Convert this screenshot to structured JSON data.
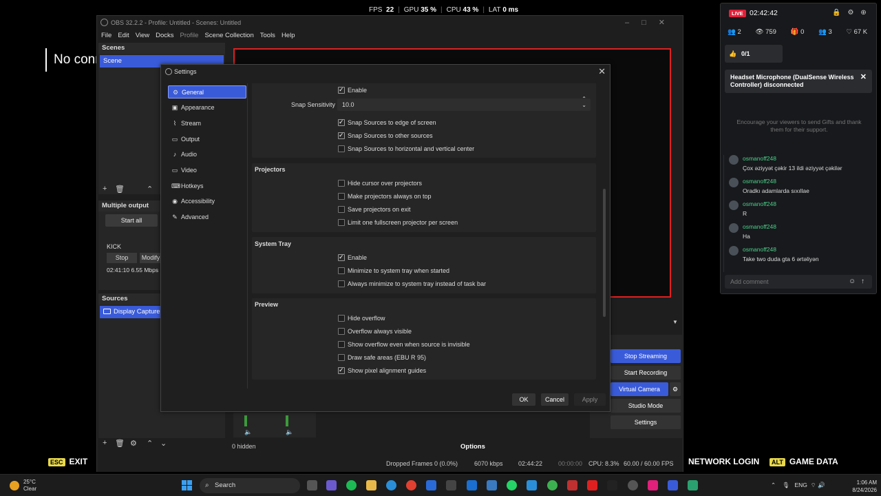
{
  "top_stats": {
    "fps_label": "FPS",
    "fps": "22",
    "gpu_label": "GPU",
    "gpu": "35 %",
    "cpu_label": "CPU",
    "cpu": "43 %",
    "lat_label": "LAT",
    "lat": "0 ms"
  },
  "overlay_left_text": "No connection",
  "obs": {
    "title": "OBS 32.2.2 - Profile: Untitled - Scenes: Untitled",
    "menu": [
      "File",
      "Edit",
      "View",
      "Docks",
      "Profile",
      "Scene Collection",
      "Tools",
      "Help"
    ],
    "scenes_header": "Scenes",
    "scene_item": "Scene",
    "multiple_output_header": "Multiple output",
    "start_all": "Start all",
    "kick_label": "KICK",
    "stop_label": "Stop",
    "modify_label": "Modify",
    "kick_stats": "02:41:10  6.55 Mbps",
    "sources_header": "Sources",
    "source_item": "Display Capture",
    "controls": {
      "stop_streaming": "Stop Streaming",
      "start_recording": "Start Recording",
      "virtual_camera": "Virtual Camera",
      "studio_mode": "Studio Mode",
      "settings": "Settings"
    },
    "hidden_label": "0 hidden",
    "options_label": "Options",
    "status": {
      "dropped": "Dropped Frames 0 (0.0%)",
      "kbps": "6070 kbps",
      "stream_time": "02:44:22",
      "rec_time": "00:00:00",
      "cpu": "CPU: 8.3%",
      "fps": "60.00 / 60.00 FPS"
    }
  },
  "hud": {
    "esc_key": "ESC",
    "exit_label": "EXIT",
    "network_login": "NETWORK LOGIN",
    "alt_key": "ALT",
    "game_data": "GAME DATA"
  },
  "chat": {
    "live_badge": "LIVE",
    "live_time": "02:42:42",
    "stats": [
      "2",
      "759",
      "0",
      "3",
      "67 K"
    ],
    "goal": "0/1",
    "notification": "Headset Microphone (DualSense Wireless Controller) disconnected",
    "encourage": "Encourage your viewers to send Gifts and thank them for their support.",
    "messages": [
      {
        "user": "osmanoff248",
        "text": "Çox əziyyət çəkir 13 ildi əziyyət çəkilər"
      },
      {
        "user": "osmanoff248",
        "text": "Oradkı adamlarda sıxıllae"
      },
      {
        "user": "osmanoff248",
        "text": "R"
      },
      {
        "user": "osmanoff248",
        "text": "Ha"
      },
      {
        "user": "osmanoff248",
        "text": "Take two duda gta 6 ərtəliyən"
      }
    ],
    "add_comment_placeholder": "Add comment"
  },
  "settings": {
    "title": "Settings",
    "nav": [
      "General",
      "Appearance",
      "Stream",
      "Output",
      "Audio",
      "Video",
      "Hotkeys",
      "Accessibility",
      "Advanced"
    ],
    "active_nav": "General",
    "snapping": {
      "enable": "Enable",
      "sensitivity_label": "Snap Sensitivity",
      "sensitivity_value": "10.0",
      "edge": "Snap Sources to edge of screen",
      "other": "Snap Sources to other sources",
      "center": "Snap Sources to horizontal and vertical center"
    },
    "projectors": {
      "title": "Projectors",
      "hide_cursor": "Hide cursor over projectors",
      "always_on_top": "Make projectors always on top",
      "save_on_exit": "Save projectors on exit",
      "limit_one": "Limit one fullscreen projector per screen"
    },
    "system_tray": {
      "title": "System Tray",
      "enable": "Enable",
      "minimize_started": "Minimize to system tray when started",
      "always_minimize": "Always minimize to system tray instead of task bar"
    },
    "preview": {
      "title": "Preview",
      "hide_overflow": "Hide overflow",
      "overflow_visible": "Overflow always visible",
      "overflow_invisible": "Show overflow even when source is invisible",
      "safe_areas": "Draw safe areas (EBU R 95)",
      "pixel_guides": "Show pixel alignment guides"
    },
    "ok": "OK",
    "cancel": "Cancel",
    "apply": "Apply"
  },
  "taskbar": {
    "temp": "25°C",
    "weather": "Clear",
    "search": "Search",
    "lang": "ENG",
    "time": "1:06 AM",
    "date": "8/24/2026"
  },
  "colors": {
    "accent": "#3a5bd9",
    "live": "#e0203a",
    "chat_user": "#4cd08a",
    "preview_border": "#e02020"
  }
}
